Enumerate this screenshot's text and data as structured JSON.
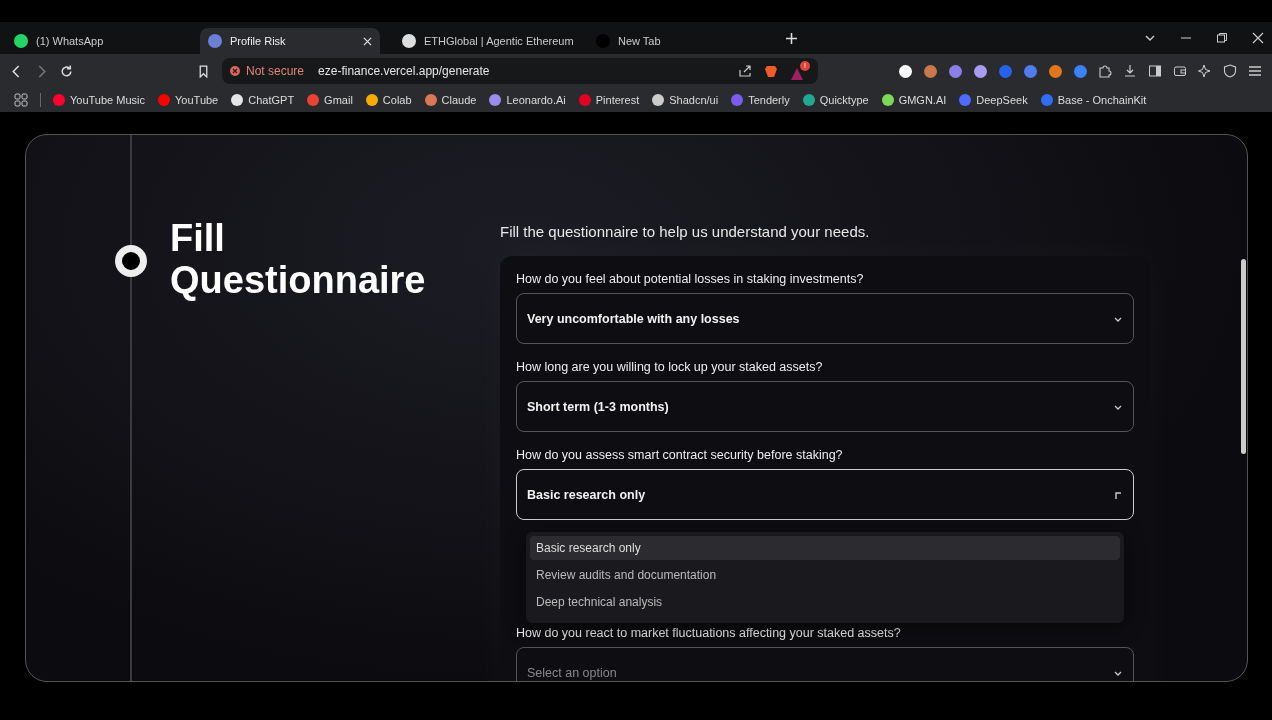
{
  "tabs": [
    {
      "title": "(1) WhatsApp",
      "selected": false,
      "color": "#25d366"
    },
    {
      "title": "Profile Risk",
      "selected": true,
      "color": "#6b7fd7"
    },
    {
      "title": "ETHGlobal | Agentic Ethereum",
      "selected": false,
      "color": "#dddddd"
    },
    {
      "title": "New Tab",
      "selected": false,
      "color": "#000000"
    }
  ],
  "address_bar": {
    "security": "Not secure",
    "url": "eze-finance.vercel.app/generate",
    "badge": "!"
  },
  "extensions": [
    {
      "color": "#ffffff"
    },
    {
      "color": "#c8784a"
    },
    {
      "color": "#8a7fe8"
    },
    {
      "color": "#a99cf0"
    },
    {
      "color": "#2563eb"
    },
    {
      "color": "#4f7df0"
    },
    {
      "color": "#e2761b"
    },
    {
      "color": "#3b82f6"
    }
  ],
  "bookmarks": [
    {
      "label": "YouTube Music",
      "color": "#ff0033"
    },
    {
      "label": "YouTube",
      "color": "#ff0000"
    },
    {
      "label": "ChatGPT",
      "color": "#e5e5e5"
    },
    {
      "label": "Gmail",
      "color": "#ea4335"
    },
    {
      "label": "Colab",
      "color": "#f9ab00"
    },
    {
      "label": "Claude",
      "color": "#d97757"
    },
    {
      "label": "Leonardo.Ai",
      "color": "#9b8cf0"
    },
    {
      "label": "Pinterest",
      "color": "#e60023"
    },
    {
      "label": "Shadcn/ui",
      "color": "#cccccc"
    },
    {
      "label": "Tenderly",
      "color": "#7b5cf0"
    },
    {
      "label": "Quicktype",
      "color": "#1fa98f"
    },
    {
      "label": "GMGN.AI",
      "color": "#7ed957"
    },
    {
      "label": "DeepSeek",
      "color": "#4d6bfe"
    },
    {
      "label": "Base - OnchainKit",
      "color": "#2f6df5"
    }
  ],
  "page": {
    "title": "Fill Questionnaire",
    "subtitle": "Fill the questionnaire to help us understand your needs.",
    "questions": [
      {
        "label": "How do you feel about potential losses in staking investments?",
        "value": "Very uncomfortable with any losses",
        "open": false
      },
      {
        "label": "How long are you willing to lock up your staked assets?",
        "value": "Short term (1-3 months)",
        "open": false
      },
      {
        "label": "How do you assess smart contract security before staking?",
        "value": "Basic research only",
        "open": true,
        "options": [
          {
            "label": "Basic research only",
            "selected": true
          },
          {
            "label": "Review audits and documentation",
            "selected": false
          },
          {
            "label": "Deep technical analysis",
            "selected": false
          }
        ]
      },
      {
        "kind": "hidden"
      },
      {
        "label": "How do you react to market fluctuations affecting your staked assets?",
        "placeholder": "Select an option",
        "open": false
      }
    ]
  }
}
